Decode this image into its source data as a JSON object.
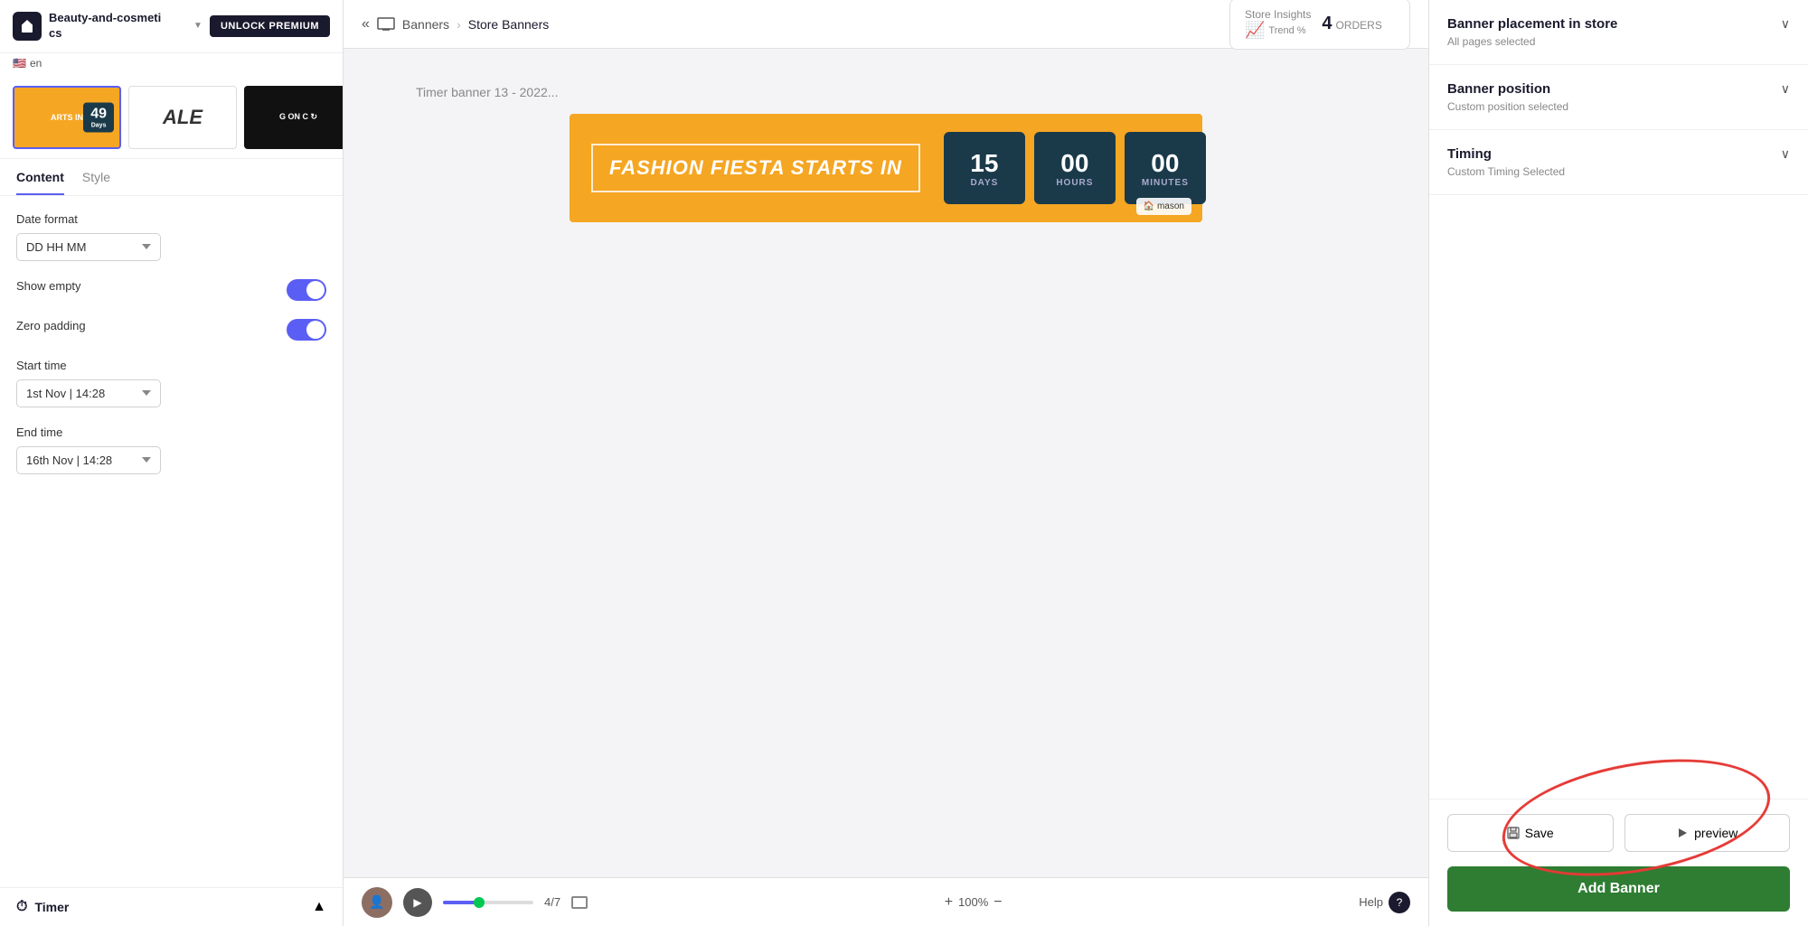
{
  "app": {
    "name_line1": "Beauty-and-cosmeti",
    "name_line2": "cs",
    "language": "en",
    "flag": "🇺🇸"
  },
  "header": {
    "unlock_premium": "UNLOCK PREMIUM",
    "breadcrumb_back": "←",
    "breadcrumb_banners": "Banners",
    "breadcrumb_sep1": ">",
    "breadcrumb_current": "Store Banners"
  },
  "store_insights": {
    "label": "Store Insights",
    "orders_count": "4",
    "orders_label": "ORDERS"
  },
  "banner_tabs": [
    {
      "id": "content",
      "label": "Content",
      "active": true
    },
    {
      "id": "style",
      "label": "Style",
      "active": false
    }
  ],
  "form": {
    "date_format_label": "Date format",
    "date_format_value": "DD HH MM",
    "show_empty_label": "Show empty",
    "zero_padding_label": "Zero padding",
    "start_time_label": "Start time",
    "start_time_value": "1st Nov | 14:28",
    "end_time_label": "End time",
    "end_time_value": "16th Nov | 14:28"
  },
  "banner_preview": {
    "title": "Timer banner 13 - 2022...",
    "text": "FASHION FIESTA STARTS IN",
    "days_num": "15",
    "days_label": "DAYS",
    "hours_num": "00",
    "hours_label": "HOURS",
    "minutes_num": "00",
    "minutes_label": "MINUTES",
    "watermark": "🏠 mason"
  },
  "bottom_bar": {
    "page_current": "4",
    "page_total": "7",
    "zoom": "100%",
    "help_label": "Help"
  },
  "right_panel": {
    "placement_title": "Banner placement in store",
    "placement_subtitle": "All pages selected",
    "position_title": "Banner position",
    "position_subtitle": "Custom position selected",
    "timing_title": "Timing",
    "timing_subtitle": "Custom Timing Selected"
  },
  "actions": {
    "save_label": "Save",
    "preview_label": "preview",
    "add_banner_label": "Add Banner"
  },
  "timer_section": {
    "label": "Timer"
  }
}
